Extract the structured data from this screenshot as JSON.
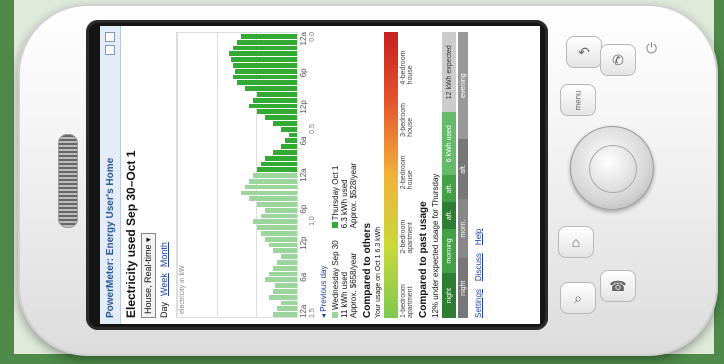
{
  "app": {
    "title": "PowerMeter: Energy User's Home",
    "heading": "Electricity used Sep 30–Oct 1",
    "location_select": "House, Real-time",
    "period_tabs": [
      "Day",
      "Week",
      "Month"
    ]
  },
  "chart": {
    "ylabel": "electricity in kW",
    "ticks_y": [
      "1.5",
      "1.0",
      "0.5",
      "0.0"
    ],
    "ticks_x": [
      "12a",
      "6a",
      "12p",
      "6p",
      "12a",
      "6a",
      "12p",
      "6p",
      "12a"
    ],
    "previous_day": "Previous day"
  },
  "chart_data": {
    "type": "area",
    "ylim": [
      0,
      1.5
    ],
    "values": [
      0.3,
      0.25,
      0.2,
      0.35,
      0.3,
      0.28,
      0.4,
      0.35,
      0.3,
      0.25,
      0.2,
      0.3,
      0.35,
      0.4,
      0.45,
      0.5,
      0.55,
      0.45,
      0.4,
      0.5,
      0.6,
      0.7,
      0.65,
      0.6,
      0.55,
      0.5,
      0.45,
      0.4,
      0.3,
      0.2,
      0.15,
      0.1,
      0.2,
      0.3,
      0.4,
      0.5,
      0.6,
      0.55,
      0.5,
      0.65,
      0.75,
      0.8,
      0.78,
      0.8,
      0.82,
      0.85,
      0.8,
      0.75,
      0.7
    ]
  },
  "stats": {
    "day1_label": "Wednesday Sep 30",
    "day1_used": "11 kWh used",
    "day1_cost": "Approx. $658/year",
    "day2_label": "Thursday Oct 1",
    "day2_used": "6.3 kWh used",
    "day2_cost": "Approx. $528/year"
  },
  "compare_others": {
    "title": "Compared to others",
    "your_usage": "Your usage on Oct 1 6.3 kWh",
    "labels": [
      "1-bedroom apartment",
      "2-bedroom apartment",
      "2-bedroom house",
      "3-bedroom house",
      "4-bedroom house"
    ]
  },
  "compare_past": {
    "title": "Compared to past usage",
    "summary": "12% under expected usage for Thursday",
    "segments": [
      "night",
      "morning",
      "aft.",
      "aft.",
      "6 kWh used"
    ],
    "segments2": [
      "night",
      "morn.",
      "aft.",
      "evening"
    ],
    "expected": "12 kWh expected"
  },
  "footer": {
    "links": [
      "Settings",
      "Discuss",
      "Help"
    ]
  },
  "hardware": {
    "menu_label": "menu"
  },
  "colors": {
    "accent": "#2b5797",
    "chart_green": "#66cc66",
    "frame_green": "#4f8a4a"
  }
}
